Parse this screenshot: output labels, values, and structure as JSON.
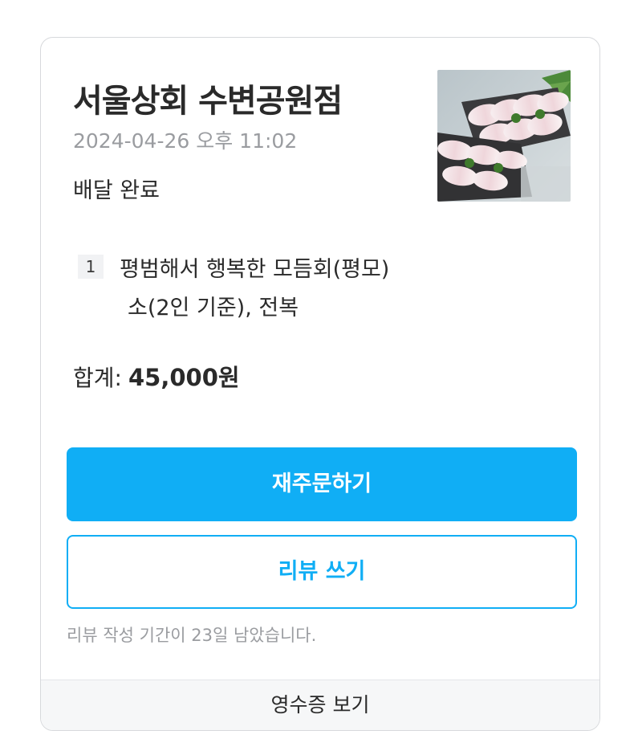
{
  "order": {
    "store_name": "서울상회 수변공원점",
    "date": "2024-04-26 오후 11:02",
    "status": "배달 완료",
    "thumbnail_icon": "sliced-raw-fish-platter-image"
  },
  "items": [
    {
      "quantity": "1",
      "name": "평범해서 행복한 모듬회(평모)",
      "option": "소(2인 기준), 전복"
    }
  ],
  "summary": {
    "total_label": "합계:",
    "total_amount": "45,000원"
  },
  "actions": {
    "reorder_label": "재주문하기",
    "review_label": "리뷰 쓰기",
    "review_note": "리뷰 작성 기간이 23일 남았습니다.",
    "receipt_label": "영수증 보기"
  },
  "colors": {
    "accent": "#10aef5",
    "muted_text": "#9a9ca0",
    "card_border": "#d7d9dc"
  }
}
